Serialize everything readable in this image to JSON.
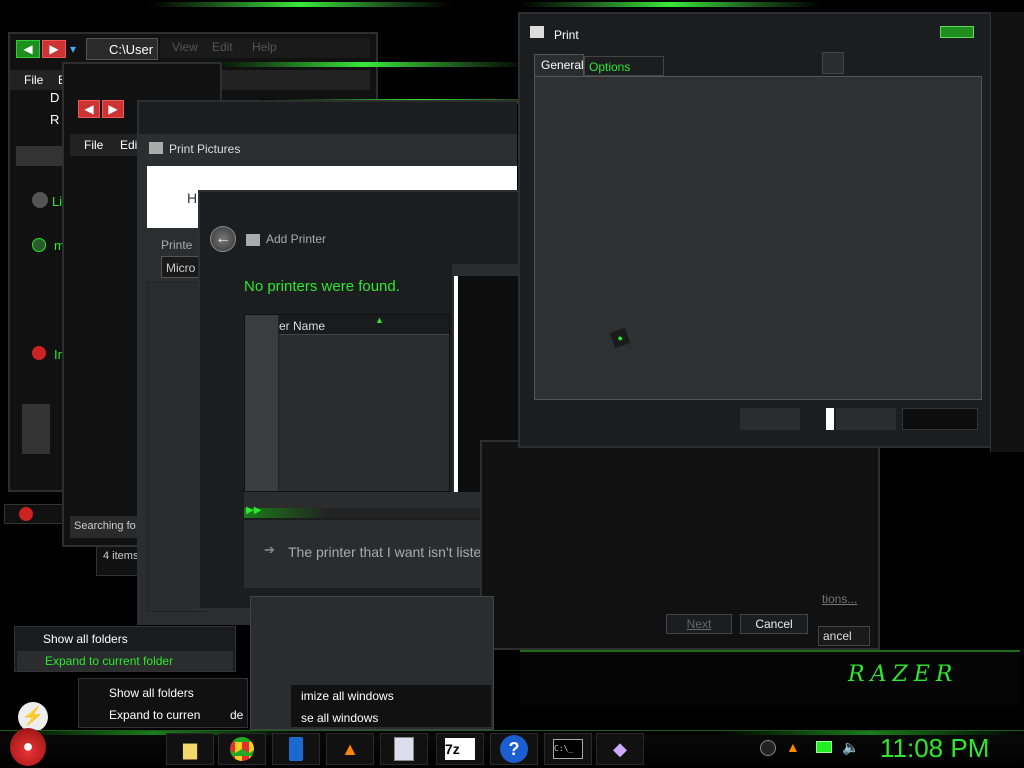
{
  "explorer_back": {
    "address": "C:\\User",
    "menu": [
      "View",
      "Edit",
      "Help"
    ],
    "file_menu": [
      "File",
      "E"
    ],
    "side_items": [
      "D",
      "R",
      "Li",
      "m",
      "In"
    ]
  },
  "explorer_mid": {
    "menu": [
      "File",
      "Edi"
    ],
    "status": "Searching fo",
    "items_count": "4 items"
  },
  "print_pictures": {
    "title": "Print Pictures",
    "heading_partial": "H",
    "printer_label": "Printe",
    "printer_value": "Micro"
  },
  "add_printer": {
    "title": "Add Printer",
    "message": "No printers were found.",
    "column_header": "er Name",
    "link": "The printer that I want isn't listed",
    "next_button": "Next",
    "cancel_button": "Cancel"
  },
  "print_dialog": {
    "title": "Print",
    "tabs": [
      "General",
      "Options"
    ]
  },
  "background_labels": {
    "options_link": "tions...",
    "cancel_partial": "ancel"
  },
  "context_menu_1": {
    "items": [
      "Show all folders",
      "Expand to current folder"
    ]
  },
  "context_menu_2": {
    "items": [
      "Show all folders",
      "Expand to curren"
    ]
  },
  "context_menu_3": {
    "items": [
      "imize all windows",
      "se all windows"
    ],
    "extra": "de"
  },
  "branding": {
    "logo": "RAZER"
  },
  "taskbar": {
    "start_icon": "angry-bird-icon",
    "pinned": [
      "folder-icon",
      "chrome-icon",
      "phone-icon",
      "vlc-icon",
      "calculator-icon",
      "7zip-icon",
      "help-icon",
      "cmd-icon",
      "paint-icon"
    ],
    "zip_label": "7z",
    "help_label": "?",
    "cmd_label": "C:\\_",
    "clock": "11:08 PM"
  },
  "colors": {
    "accent": "#2ee82e",
    "window_bg": "#1a1b1c",
    "panel": "#2a2c2e"
  }
}
